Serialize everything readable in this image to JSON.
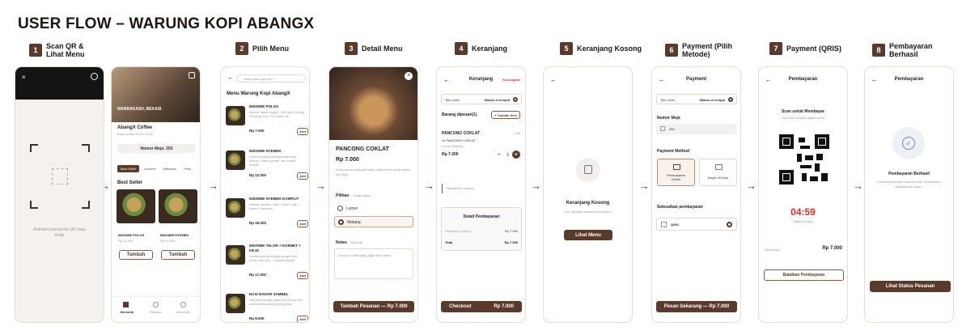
{
  "title": "USER FLOW – WARUNG KOPI ABANGX",
  "steps": [
    {
      "num": "1",
      "label": "Scan QR & Lihat Menu"
    },
    {
      "num": "2",
      "label": "Pilih Menu"
    },
    {
      "num": "3",
      "label": "Detail Menu"
    },
    {
      "num": "4",
      "label": "Keranjang"
    },
    {
      "num": "5",
      "label": "Keranjang Kosong"
    },
    {
      "num": "6",
      "label": "Payment (Pilih Metode)"
    },
    {
      "num": "7",
      "label": "Payment (QRIS)"
    },
    {
      "num": "8",
      "label": "Pembayaran Berhasil"
    }
  ],
  "arrow": "→",
  "scan": {
    "close": "×",
    "hint": "Arahkan kamera ke QR meja Anda"
  },
  "home": {
    "location": "MARRAKASH, BEKASI",
    "store": "AbangX Coffee",
    "hours": "Buka setiap 08:00–22:00",
    "table": "Nomor Meja: 250",
    "tabs": [
      "Best Seller",
      "Indomie",
      "Makanan",
      "Persi"
    ],
    "section": "Best Seller",
    "items": [
      {
        "name": "INDOMIE POLOS",
        "price": "Rp 10.000"
      },
      {
        "name": "INDOMIE NYEMEK",
        "price": "Rp 14.000"
      }
    ],
    "add_label": "Tambah",
    "nav": [
      "Beranda",
      "Riwayat",
      "Informasi"
    ]
  },
  "menu": {
    "search_placeholder": "Mau pesan apa nih?",
    "heading": "Menu Warung Kopi AbangX",
    "add_label": "Add",
    "items": [
      {
        "name": "INDOMIE POLOS",
        "desc": "Indomie klasik original + pilih rasa: Goreng, Rendang, Aceh, Kari Ayam, dll",
        "price": "Rp 7.000"
      },
      {
        "name": "INDOMIE NYEMEK",
        "desc": "Indomie goreng setengah kuah khas AbangX, super nyemek, dan bumbu, rempah",
        "price": "Rp 12.000"
      },
      {
        "name": "INDOMIE NYEMEK KOMPLIT",
        "desc": "Indomie nyemek + telur + sawi + keju + kornet + mericuan",
        "price": "Rp 16.000"
      },
      {
        "name": "INDOMIE TELOR + KORNET + KEJU",
        "desc": "Indomie goreng lengkap dengan telur, kornet, dan keju — komplet banget",
        "price": "Rp 17.000"
      },
      {
        "name": "NASI DADAR SAMBEL",
        "desc": "Nasi putih dengan dadar telur renyah dan sambal khas warung yang pedas",
        "price": "Rp 8.000"
      }
    ]
  },
  "detail": {
    "name": "PANCONG COKLAT",
    "price": "Rp 7.000",
    "desc": "Kue pancong dengan isian coklat lumer yang manis dan legit",
    "choice_label": "Pilihan",
    "choice_hint": "Wajib dipilih",
    "options": [
      "Lumer",
      "Matang"
    ],
    "notes_label": "Notes",
    "notes_hint": "Optional",
    "notes_placeholder": "Example: Mau yang agak dikit manis",
    "cta": "Tambah Pesanan — Rp 7.000"
  },
  "cart": {
    "title": "Keranjang",
    "clear": "Kosongkan",
    "order_type": "Tipe order",
    "order_value": "Makan di tempat",
    "items_label": "Barang dipesan(1)",
    "add_item": "+ Tambah Item",
    "item_name": "PANCONG COKLAT",
    "edit": "Edit",
    "item_qty": "1x PANCONG COKLAT",
    "item_opts": "Lumer  Matang",
    "item_price": "Rp 7.000",
    "qty": "1",
    "note_placeholder": "Tambahkan catatan",
    "summary_title": "Detail Pembayaran",
    "subtotal_label": "Subtotal (1 menu)",
    "subtotal": "Rp 7.000",
    "total_label": "Total",
    "total": "Rp 7.000",
    "checkout": "Checkout",
    "checkout_price": "Rp 7.000"
  },
  "empty": {
    "title": "Keranjang Kosong",
    "desc": "Yuk, tambah makanan favoritmu!",
    "cta": "Lihat Menu"
  },
  "payment": {
    "title": "Payment",
    "order_type": "Tipe order",
    "order_value": "Makan di tempat",
    "table_label": "Nomor Meja",
    "table_value": "250",
    "method_label": "Payment Method",
    "methods": [
      "Pembayaran Online",
      "Bayar di Kasir"
    ],
    "finish_label": "Selesaikan pembayaran",
    "qris": "QRIS",
    "cta": "Pesan Sekarang — Rp 7.000"
  },
  "qris": {
    "title": "Pembayaran",
    "scan_title": "Scan untuk Membayar",
    "scan_hint": "Gunakan dompet digital kamu",
    "timer": "04:59",
    "timer_hint": "Waktu tersisa",
    "total_label": "Total Bayar",
    "total": "Rp 7.000",
    "cancel": "Batalkan Pembayaran"
  },
  "success": {
    "title": "Pembayaran",
    "heading": "Pembayaran Berhasil",
    "desc": "Pembayaran telah dikonfirmasi. Pesananmu disiapkan ke dapur.",
    "cta": "Lihat Status Pesanan"
  },
  "colors": {
    "brand": "#5a3a2b",
    "accent": "#d9302a",
    "bg": "#ffffff"
  }
}
